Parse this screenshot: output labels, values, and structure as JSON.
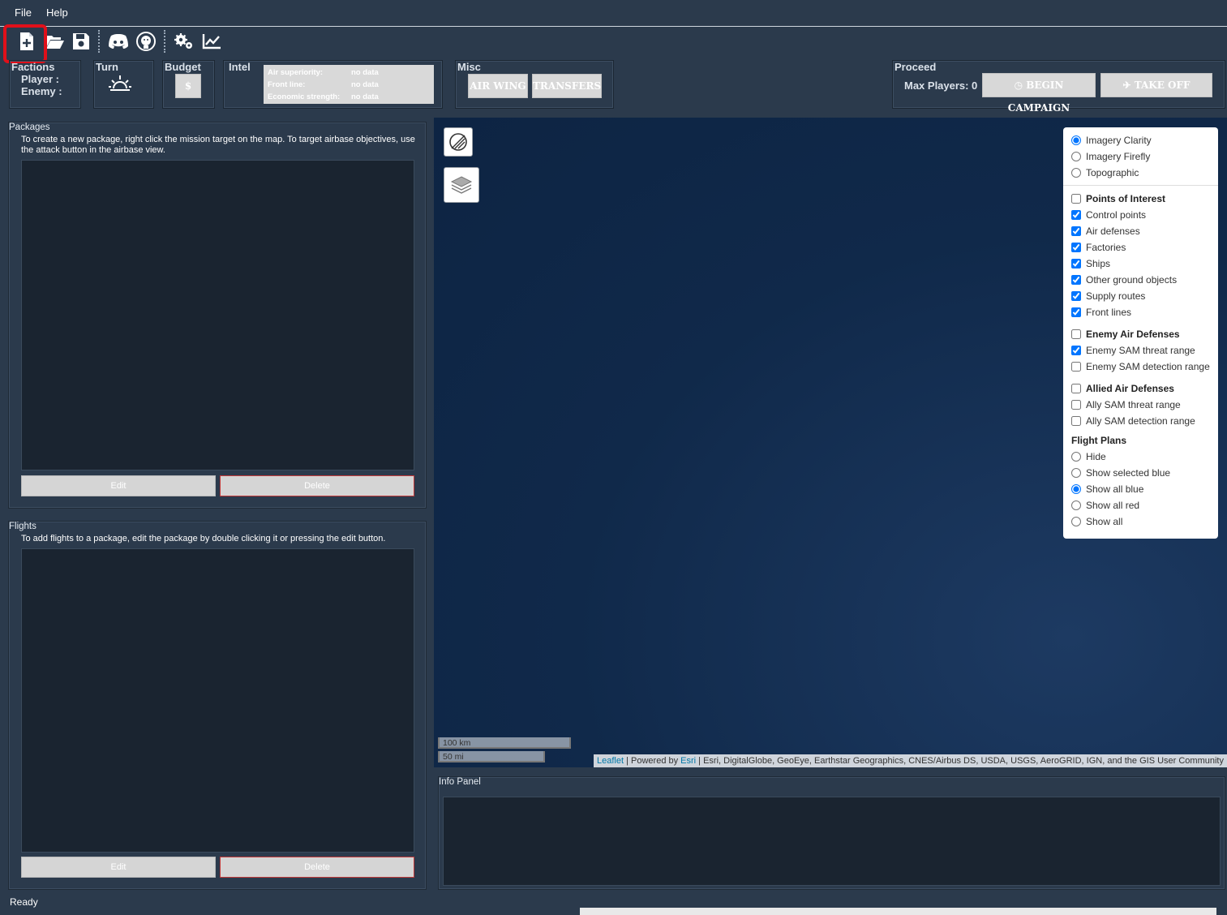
{
  "menubar": {
    "file": "File",
    "help": "Help"
  },
  "toolbar": {
    "icons": [
      "new-file-icon",
      "open-folder-icon",
      "save-icon",
      "discord-icon",
      "github-icon",
      "settings-gear-icon",
      "stats-chart-icon"
    ]
  },
  "factions": {
    "title": "Factions",
    "player": "Player :",
    "enemy": "Enemy :"
  },
  "turn": {
    "title": "Turn"
  },
  "budget": {
    "title": "Budget",
    "button": "$"
  },
  "intel": {
    "title": "Intel",
    "rows": [
      {
        "label": "Air superiority:",
        "value": "no data"
      },
      {
        "label": "Front line:",
        "value": "no data"
      },
      {
        "label": "Economic strength:",
        "value": "no data"
      }
    ]
  },
  "misc": {
    "title": "Misc",
    "air_wing": "AIR WING",
    "transfers": "TRANSFERS"
  },
  "proceed": {
    "title": "Proceed",
    "max_players": "Max Players:",
    "max_players_value": "0",
    "begin": "BEGIN CAMPAIGN",
    "takeoff": "TAKE OFF"
  },
  "packages": {
    "title": "Packages",
    "note": "To create a new package, right click the mission target on the map. To target airbase objectives, use the attack button in the airbase view.",
    "edit": "Edit",
    "delete": "Delete"
  },
  "flights": {
    "title": "Flights",
    "note": "To add flights to a package, edit the package by double clicking it or pressing the edit button.",
    "edit": "Edit",
    "delete": "Delete"
  },
  "map": {
    "basemaps": [
      {
        "label": "Imagery Clarity",
        "checked": true
      },
      {
        "label": "Imagery Firefly",
        "checked": false
      },
      {
        "label": "Topographic",
        "checked": false
      }
    ],
    "overlays": [
      {
        "label": "Points of Interest",
        "checked": false,
        "head": true
      },
      {
        "label": "Control points",
        "checked": true
      },
      {
        "label": "Air defenses",
        "checked": true
      },
      {
        "label": "Factories",
        "checked": true
      },
      {
        "label": "Ships",
        "checked": true
      },
      {
        "label": "Other ground objects",
        "checked": true
      },
      {
        "label": "Supply routes",
        "checked": true
      },
      {
        "label": "Front lines",
        "checked": true
      },
      {
        "label": "Enemy Air Defenses",
        "checked": false,
        "head": true
      },
      {
        "label": "Enemy SAM threat range",
        "checked": true
      },
      {
        "label": "Enemy SAM detection range",
        "checked": false
      },
      {
        "label": "Allied Air Defenses",
        "checked": false,
        "head": true
      },
      {
        "label": "Ally SAM threat range",
        "checked": false
      },
      {
        "label": "Ally SAM detection range",
        "checked": false
      }
    ],
    "flight_plans_title": "Flight Plans",
    "flight_plans": [
      {
        "label": "Hide",
        "checked": false
      },
      {
        "label": "Show selected blue",
        "checked": false
      },
      {
        "label": "Show all blue",
        "checked": true
      },
      {
        "label": "Show all red",
        "checked": false
      },
      {
        "label": "Show all",
        "checked": false
      }
    ],
    "scale_km": "100 km",
    "scale_mi": "50 mi",
    "attribution_leaflet": "Leaflet",
    "attribution_powered": " | Powered by ",
    "attribution_esri": "Esri",
    "attribution_rest": " | Esri, DigitalGlobe, GeoEye, Earthstar Geographics, CNES/Airbus DS, USDA, USGS, AeroGRID, IGN, and the GIS User Community"
  },
  "info_panel": {
    "title": "Info Panel"
  },
  "status": {
    "text": "Ready"
  }
}
